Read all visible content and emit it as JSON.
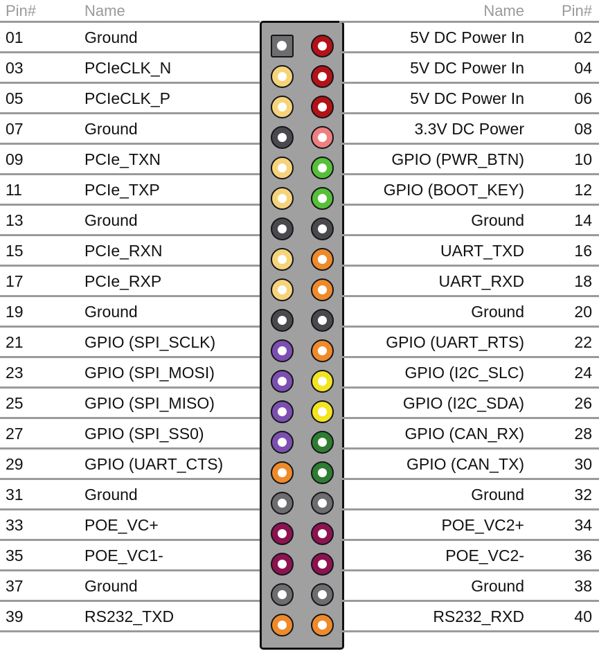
{
  "headers": {
    "left_pin": "Pin#",
    "left_name": "Name",
    "right_name": "Name",
    "right_pin": "Pin#"
  },
  "colors": {
    "header_text": "#9a9a9a",
    "body_text": "#111111",
    "rule": "#9a9a9a",
    "connector_body": "#a0a0a0",
    "connector_border": "#111111",
    "pad_ground": "#4a4a4e",
    "pad_ground_light": "#6d6d70",
    "pad_yellow": "#f6d37a",
    "pad_red": "#b31217",
    "pad_salmon": "#ef7f7f",
    "pad_green_bright": "#56c038",
    "pad_orange": "#ee8a2a",
    "pad_purple": "#7c4fb0",
    "pad_yellow_bright": "#f2e41e",
    "pad_green_dark": "#2f7d32",
    "pad_magenta": "#8d1350",
    "pad_pin1": "#6d6d70"
  },
  "left_rows": [
    {
      "pin": "01",
      "name": "Ground"
    },
    {
      "pin": "03",
      "name": "PCIeCLK_N"
    },
    {
      "pin": "05",
      "name": "PCIeCLK_P"
    },
    {
      "pin": "07",
      "name": "Ground"
    },
    {
      "pin": "09",
      "name": "PCIe_TXN"
    },
    {
      "pin": "11",
      "name": "PCIe_TXP"
    },
    {
      "pin": "13",
      "name": "Ground"
    },
    {
      "pin": "15",
      "name": "PCIe_RXN"
    },
    {
      "pin": "17",
      "name": "PCIe_RXP"
    },
    {
      "pin": "19",
      "name": "Ground"
    },
    {
      "pin": "21",
      "name": "GPIO (SPI_SCLK)"
    },
    {
      "pin": "23",
      "name": "GPIO (SPI_MOSI)"
    },
    {
      "pin": "25",
      "name": "GPIO (SPI_MISO)"
    },
    {
      "pin": "27",
      "name": "GPIO (SPI_SS0)"
    },
    {
      "pin": "29",
      "name": "GPIO (UART_CTS)"
    },
    {
      "pin": "31",
      "name": "Ground"
    },
    {
      "pin": "33",
      "name": "POE_VC+"
    },
    {
      "pin": "35",
      "name": "POE_VC1-"
    },
    {
      "pin": "37",
      "name": "Ground"
    },
    {
      "pin": "39",
      "name": "RS232_TXD"
    }
  ],
  "right_rows": [
    {
      "pin": "02",
      "name": "5V DC Power In"
    },
    {
      "pin": "04",
      "name": "5V DC Power In"
    },
    {
      "pin": "06",
      "name": "5V DC Power In"
    },
    {
      "pin": "08",
      "name": "3.3V DC Power"
    },
    {
      "pin": "10",
      "name": "GPIO (PWR_BTN)"
    },
    {
      "pin": "12",
      "name": "GPIO (BOOT_KEY)"
    },
    {
      "pin": "14",
      "name": "Ground"
    },
    {
      "pin": "16",
      "name": "UART_TXD"
    },
    {
      "pin": "18",
      "name": "UART_RXD"
    },
    {
      "pin": "20",
      "name": "Ground"
    },
    {
      "pin": "22",
      "name": "GPIO (UART_RTS)"
    },
    {
      "pin": "24",
      "name": "GPIO (I2C_SLC)"
    },
    {
      "pin": "26",
      "name": "GPIO (I2C_SDA)"
    },
    {
      "pin": "28",
      "name": "GPIO (CAN_RX)"
    },
    {
      "pin": "30",
      "name": "GPIO (CAN_TX)"
    },
    {
      "pin": "32",
      "name": "Ground"
    },
    {
      "pin": "34",
      "name": "POE_VC2+"
    },
    {
      "pin": "36",
      "name": "POE_VC2-"
    },
    {
      "pin": "38",
      "name": "Ground"
    },
    {
      "pin": "40",
      "name": "RS232_RXD"
    }
  ],
  "connector": {
    "rows": [
      {
        "left_pin": "01",
        "right_pin": "02",
        "left_color": "#6d6d70",
        "right_color": "#b31217",
        "left_shape": "square",
        "right_shape": "circle"
      },
      {
        "left_pin": "03",
        "right_pin": "04",
        "left_color": "#f6d37a",
        "right_color": "#b31217",
        "left_shape": "circle",
        "right_shape": "circle"
      },
      {
        "left_pin": "05",
        "right_pin": "06",
        "left_color": "#f6d37a",
        "right_color": "#b31217",
        "left_shape": "circle",
        "right_shape": "circle"
      },
      {
        "left_pin": "07",
        "right_pin": "08",
        "left_color": "#4a4a4e",
        "right_color": "#ef7f7f",
        "left_shape": "circle",
        "right_shape": "circle"
      },
      {
        "left_pin": "09",
        "right_pin": "10",
        "left_color": "#f6d37a",
        "right_color": "#56c038",
        "left_shape": "circle",
        "right_shape": "circle"
      },
      {
        "left_pin": "11",
        "right_pin": "12",
        "left_color": "#f6d37a",
        "right_color": "#56c038",
        "left_shape": "circle",
        "right_shape": "circle"
      },
      {
        "left_pin": "13",
        "right_pin": "14",
        "left_color": "#4a4a4e",
        "right_color": "#4a4a4e",
        "left_shape": "circle",
        "right_shape": "circle"
      },
      {
        "left_pin": "15",
        "right_pin": "16",
        "left_color": "#f6d37a",
        "right_color": "#ee8a2a",
        "left_shape": "circle",
        "right_shape": "circle"
      },
      {
        "left_pin": "17",
        "right_pin": "18",
        "left_color": "#f6d37a",
        "right_color": "#ee8a2a",
        "left_shape": "circle",
        "right_shape": "circle"
      },
      {
        "left_pin": "19",
        "right_pin": "20",
        "left_color": "#4a4a4e",
        "right_color": "#4a4a4e",
        "left_shape": "circle",
        "right_shape": "circle"
      },
      {
        "left_pin": "21",
        "right_pin": "22",
        "left_color": "#7c4fb0",
        "right_color": "#ee8a2a",
        "left_shape": "circle",
        "right_shape": "circle"
      },
      {
        "left_pin": "23",
        "right_pin": "24",
        "left_color": "#7c4fb0",
        "right_color": "#f2e41e",
        "left_shape": "circle",
        "right_shape": "circle"
      },
      {
        "left_pin": "25",
        "right_pin": "26",
        "left_color": "#7c4fb0",
        "right_color": "#f2e41e",
        "left_shape": "circle",
        "right_shape": "circle"
      },
      {
        "left_pin": "27",
        "right_pin": "28",
        "left_color": "#7c4fb0",
        "right_color": "#2f7d32",
        "left_shape": "circle",
        "right_shape": "circle"
      },
      {
        "left_pin": "29",
        "right_pin": "30",
        "left_color": "#ee8a2a",
        "right_color": "#2f7d32",
        "left_shape": "circle",
        "right_shape": "circle"
      },
      {
        "left_pin": "31",
        "right_pin": "32",
        "left_color": "#6d6d70",
        "right_color": "#6d6d70",
        "left_shape": "circle",
        "right_shape": "circle"
      },
      {
        "left_pin": "33",
        "right_pin": "34",
        "left_color": "#8d1350",
        "right_color": "#8d1350",
        "left_shape": "circle",
        "right_shape": "circle"
      },
      {
        "left_pin": "35",
        "right_pin": "36",
        "left_color": "#8d1350",
        "right_color": "#8d1350",
        "left_shape": "circle",
        "right_shape": "circle"
      },
      {
        "left_pin": "37",
        "right_pin": "38",
        "left_color": "#6d6d70",
        "right_color": "#6d6d70",
        "left_shape": "circle",
        "right_shape": "circle"
      },
      {
        "left_pin": "39",
        "right_pin": "40",
        "left_color": "#ee8a2a",
        "right_color": "#ee8a2a",
        "left_shape": "circle",
        "right_shape": "circle"
      }
    ]
  }
}
